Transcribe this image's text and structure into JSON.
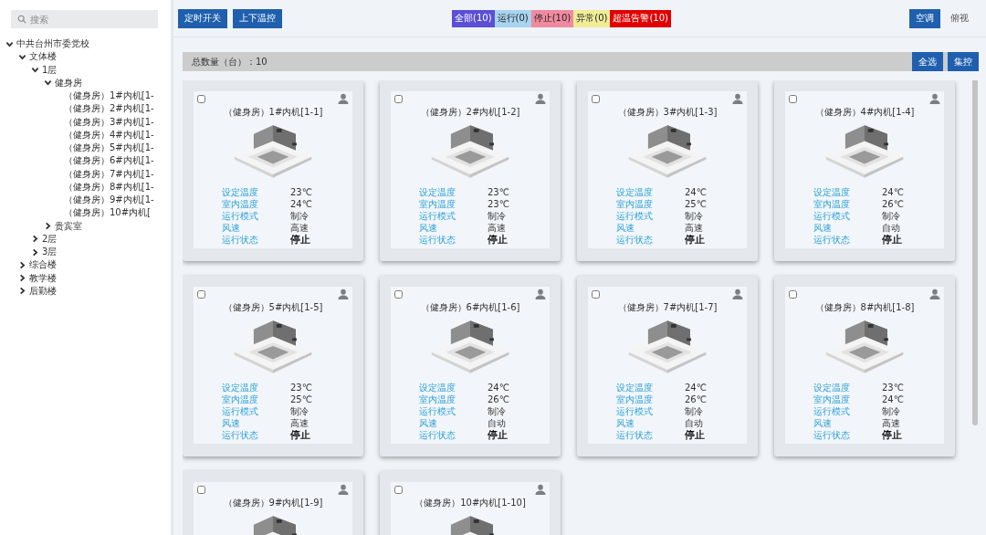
{
  "sidebar": {
    "search": {
      "placeholder": "搜索"
    },
    "tree": [
      {
        "label": "中共台州市委党校",
        "expanded": true,
        "children": [
          {
            "label": "文体楼",
            "expanded": true,
            "children": [
              {
                "label": "1层",
                "expanded": true,
                "children": [
                  {
                    "label": "健身房",
                    "expanded": true,
                    "children": [
                      {
                        "label": "（健身房）1#内机[1-"
                      },
                      {
                        "label": "（健身房）2#内机[1-"
                      },
                      {
                        "label": "（健身房）3#内机[1-"
                      },
                      {
                        "label": "（健身房）4#内机[1-"
                      },
                      {
                        "label": "（健身房）5#内机[1-"
                      },
                      {
                        "label": "（健身房）6#内机[1-"
                      },
                      {
                        "label": "（健身房）7#内机[1-"
                      },
                      {
                        "label": "（健身房）8#内机[1-"
                      },
                      {
                        "label": "（健身房）9#内机[1-"
                      },
                      {
                        "label": "（健身房）10#内机["
                      }
                    ]
                  },
                  {
                    "label": "贵宾室",
                    "expanded": false
                  }
                ]
              },
              {
                "label": "2层",
                "expanded": false
              },
              {
                "label": "3层",
                "expanded": false
              }
            ]
          },
          {
            "label": "综合楼",
            "expanded": false
          },
          {
            "label": "教学楼",
            "expanded": false
          },
          {
            "label": "后勤楼",
            "expanded": false
          }
        ]
      }
    ]
  },
  "toolbar": {
    "buttons": [
      "定时开关",
      "上下温控"
    ],
    "filters": [
      {
        "label": "全部(10)",
        "color": "#5b4fd6"
      },
      {
        "label": "运行(0)",
        "color": "#a8d4f0"
      },
      {
        "label": "停止(10)",
        "color": "#f08aa0"
      },
      {
        "label": "异常(0)",
        "color": "#f0ec98"
      },
      {
        "label": "超温告警(10)",
        "color": "#e00000"
      }
    ],
    "views": [
      {
        "label": "空调",
        "selected": true
      },
      {
        "label": "俯视",
        "selected": false
      }
    ]
  },
  "summary": {
    "count": "总数量（台）：10",
    "buttons": [
      "全选",
      "集控"
    ]
  },
  "cards": [
    {
      "title": "（健身房）1#内机[1-1]",
      "checked": false,
      "fields": [
        {
          "label": "设定温度",
          "value": "23℃"
        },
        {
          "label": "室内温度",
          "value": "24℃"
        },
        {
          "label": "运行模式",
          "value": "制冷"
        },
        {
          "label": "风速",
          "value": "高速"
        },
        {
          "label": "运行状态",
          "value": "停止"
        }
      ]
    },
    {
      "title": "（健身房）2#内机[1-2]",
      "checked": false,
      "fields": [
        {
          "label": "设定温度",
          "value": "23℃"
        },
        {
          "label": "室内温度",
          "value": "23℃"
        },
        {
          "label": "运行模式",
          "value": "制冷"
        },
        {
          "label": "风速",
          "value": "高速"
        },
        {
          "label": "运行状态",
          "value": "停止"
        }
      ]
    },
    {
      "title": "（健身房）3#内机[1-3]",
      "checked": false,
      "fields": [
        {
          "label": "设定温度",
          "value": "24℃"
        },
        {
          "label": "室内温度",
          "value": "25℃"
        },
        {
          "label": "运行模式",
          "value": "制冷"
        },
        {
          "label": "风速",
          "value": "高速"
        },
        {
          "label": "运行状态",
          "value": "停止"
        }
      ]
    },
    {
      "title": "（健身房）4#内机[1-4]",
      "checked": false,
      "fields": [
        {
          "label": "设定温度",
          "value": "24℃"
        },
        {
          "label": "室内温度",
          "value": "26℃"
        },
        {
          "label": "运行模式",
          "value": "制冷"
        },
        {
          "label": "风速",
          "value": "自动"
        },
        {
          "label": "运行状态",
          "value": "停止"
        }
      ]
    },
    {
      "title": "（健身房）5#内机[1-5]",
      "checked": false,
      "fields": [
        {
          "label": "设定温度",
          "value": "23℃"
        },
        {
          "label": "室内温度",
          "value": "25℃"
        },
        {
          "label": "运行模式",
          "value": "制冷"
        },
        {
          "label": "风速",
          "value": "高速"
        },
        {
          "label": "运行状态",
          "value": "停止"
        }
      ]
    },
    {
      "title": "（健身房）6#内机[1-6]",
      "checked": false,
      "fields": [
        {
          "label": "设定温度",
          "value": "24℃"
        },
        {
          "label": "室内温度",
          "value": "26℃"
        },
        {
          "label": "运行模式",
          "value": "制冷"
        },
        {
          "label": "风速",
          "value": "自动"
        },
        {
          "label": "运行状态",
          "value": "停止"
        }
      ]
    },
    {
      "title": "（健身房）7#内机[1-7]",
      "checked": false,
      "fields": [
        {
          "label": "设定温度",
          "value": "24℃"
        },
        {
          "label": "室内温度",
          "value": "26℃"
        },
        {
          "label": "运行模式",
          "value": "制冷"
        },
        {
          "label": "风速",
          "value": "自动"
        },
        {
          "label": "运行状态",
          "value": "停止"
        }
      ]
    },
    {
      "title": "（健身房）8#内机[1-8]",
      "checked": false,
      "fields": [
        {
          "label": "设定温度",
          "value": "23℃"
        },
        {
          "label": "室内温度",
          "value": "24℃"
        },
        {
          "label": "运行模式",
          "value": "制冷"
        },
        {
          "label": "风速",
          "value": "高速"
        },
        {
          "label": "运行状态",
          "value": "停止"
        }
      ]
    },
    {
      "title": "（健身房）9#内机[1-9]",
      "checked": false
    },
    {
      "title": "（健身房）10#内机[1-10]",
      "checked": false
    }
  ]
}
